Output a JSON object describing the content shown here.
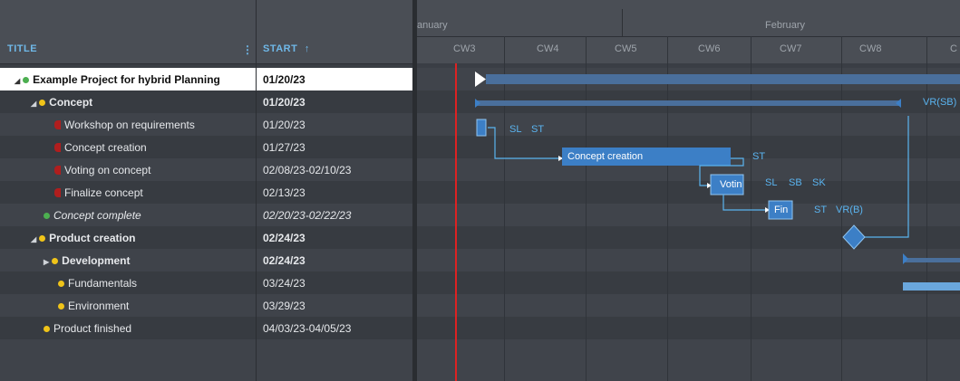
{
  "grid": {
    "col_title": "TITLE",
    "col_title_menu": "⋮",
    "col_start": "START",
    "sort_icon": "↑"
  },
  "rows": [
    {
      "tri": "◢",
      "name": "Example Project for hybrid Planning",
      "start": "01/20/23",
      "dot": "#4caf50"
    },
    {
      "tri": "◢",
      "name": "Concept",
      "start": "01/20/23",
      "dot": "#f0c419"
    },
    {
      "name": "Workshop on requirements",
      "start": "01/20/23",
      "square": "#b01e1e"
    },
    {
      "name": "Concept creation",
      "start": "01/27/23",
      "square": "#b01e1e"
    },
    {
      "name": "Voting on concept",
      "start": "02/08/23-02/10/23",
      "square": "#b01e1e"
    },
    {
      "name": "Finalize concept",
      "start": "02/13/23",
      "square": "#b01e1e"
    },
    {
      "name": "Concept complete",
      "start": "02/20/23-02/22/23",
      "dot": "#4caf50"
    },
    {
      "tri": "◢",
      "name": "Product creation",
      "start": "02/24/23",
      "dot": "#f0c419"
    },
    {
      "tri": "▶",
      "name": "Development",
      "start": "02/24/23",
      "dot": "#f0c419"
    },
    {
      "name": "Fundamentals",
      "start": "03/24/23",
      "dot": "#f0c419"
    },
    {
      "name": "Environment",
      "start": "03/29/23",
      "dot": "#f0c419"
    },
    {
      "name": "Product finished",
      "start": "04/03/23-04/05/23",
      "dot": "#f0c419"
    }
  ],
  "gantt": {
    "months": [
      "anuary",
      "February"
    ],
    "weeks": [
      "CW3",
      "CW4",
      "CW5",
      "CW6",
      "CW7",
      "CW8",
      "C"
    ],
    "bar_concept_creation": "Concept creation",
    "bar_voting": "Votin",
    "bar_finalize": "Fin",
    "labels": {
      "concept_vr": "VR(SB)",
      "workshop_sl": "SL",
      "workshop_st": "ST",
      "concept_creation_st": "ST",
      "voting_sl": "SL",
      "voting_sb": "SB",
      "voting_sk": "SK",
      "finalize_st": "ST",
      "finalize_vr": "VR(B)"
    }
  },
  "colors": {
    "accent": "#6fb8e8",
    "bar": "#3c7fc6",
    "summary_bar": "#4a6f9c",
    "today_line": "#d22222",
    "selected_row": "#ffffff"
  }
}
